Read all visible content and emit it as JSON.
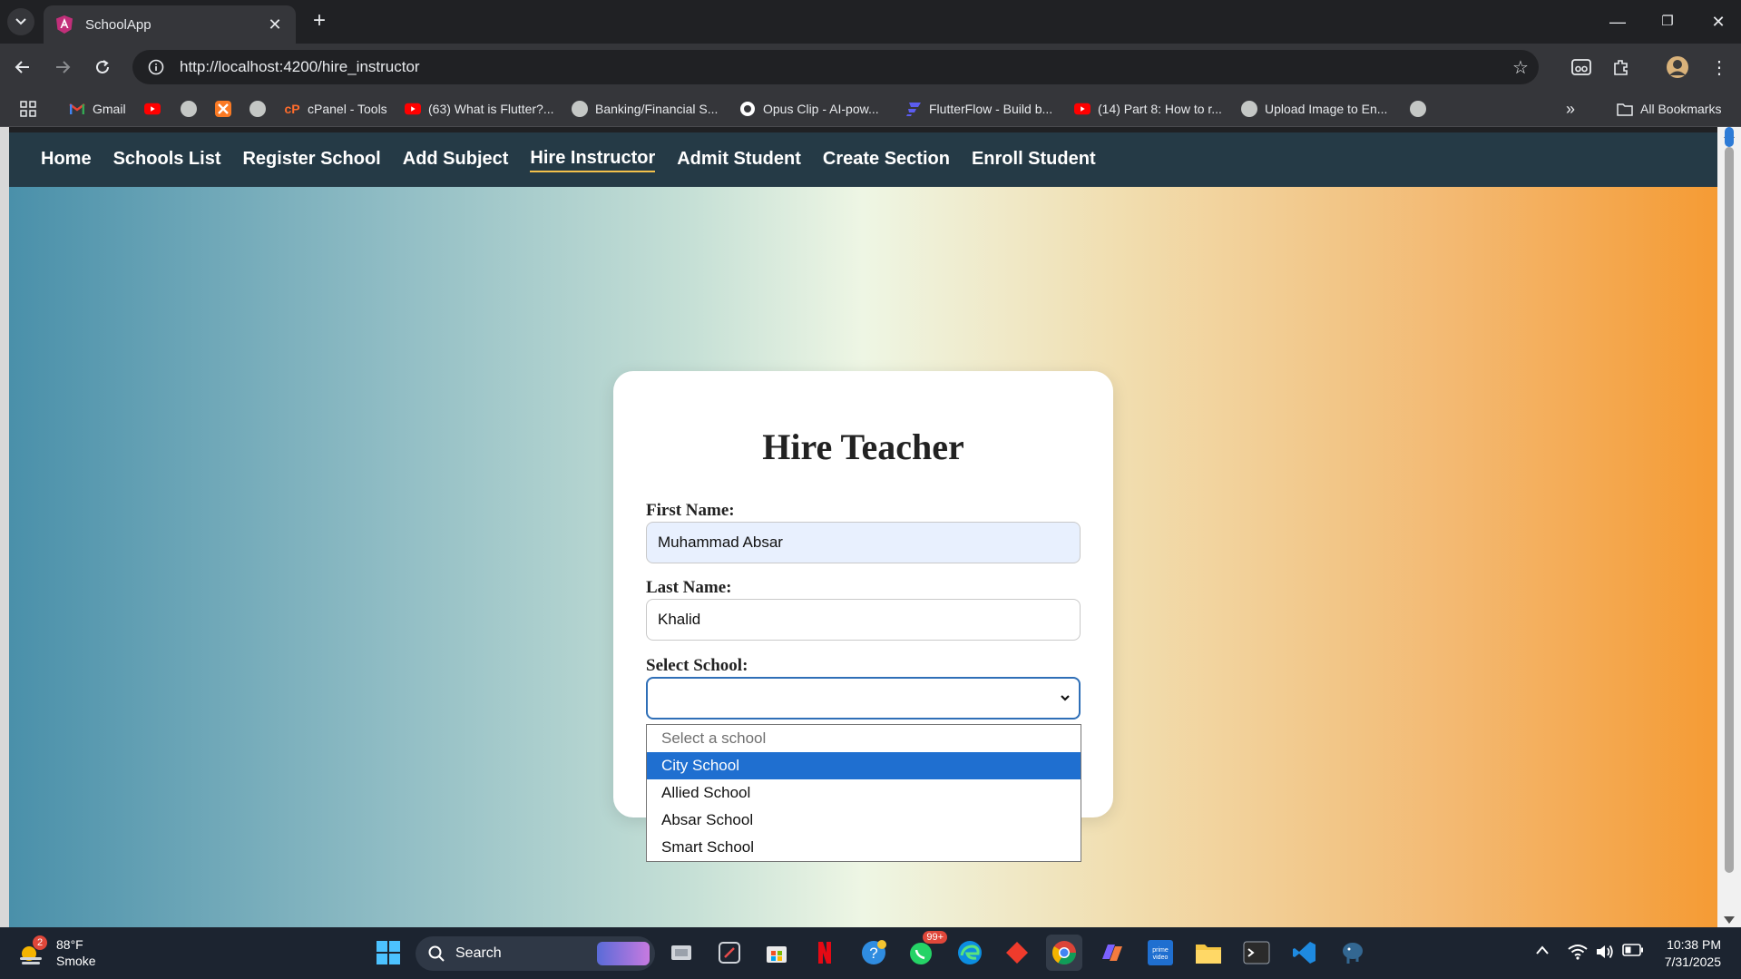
{
  "browser": {
    "tab_title": "SchoolApp",
    "url": "http://localhost:4200/hire_instructor",
    "bookmarks": [
      {
        "label": "Gmail",
        "icon": "gmail-icon"
      },
      {
        "label": "",
        "icon": "youtube-icon"
      },
      {
        "label": "",
        "icon": "globe-icon"
      },
      {
        "label": "",
        "icon": "xampp-icon"
      },
      {
        "label": "",
        "icon": "globe-icon"
      },
      {
        "label": "cPanel - Tools",
        "icon": "cpanel-icon"
      },
      {
        "label": "(63) What is Flutter?...",
        "icon": "youtube-icon"
      },
      {
        "label": "Banking/Financial S...",
        "icon": "globe-icon"
      },
      {
        "label": "Opus Clip - AI-pow...",
        "icon": "opus-icon"
      },
      {
        "label": "FlutterFlow - Build b...",
        "icon": "flutterflow-icon"
      },
      {
        "label": "(14) Part 8: How to r...",
        "icon": "youtube-icon"
      },
      {
        "label": "Upload Image to En...",
        "icon": "globe-icon"
      },
      {
        "label": "",
        "icon": "globe-icon"
      }
    ],
    "all_bookmarks": "All Bookmarks"
  },
  "nav": {
    "links": [
      "Home",
      "Schools List",
      "Register School",
      "Add Subject",
      "Hire Instructor",
      "Admit Student",
      "Create Section",
      "Enroll Student"
    ],
    "active": "Hire Instructor"
  },
  "form": {
    "title": "Hire Teacher",
    "first_name_label": "First Name:",
    "first_name_value": "Muhammad Absar",
    "last_name_label": "Last Name:",
    "last_name_value": "Khalid",
    "school_label": "Select School:",
    "school_value": "",
    "school_options": [
      "Select a school",
      "City School",
      "Allied School",
      "Absar School",
      "Smart School"
    ],
    "highlighted_option": "City School"
  },
  "taskbar": {
    "weather_temp": "88°F",
    "weather_desc": "Smoke",
    "weather_badge": "2",
    "search_label": "Search",
    "whatsapp_badge": "99+",
    "time": "10:38 PM",
    "date": "7/31/2025"
  },
  "colors": {
    "navbar": "#253a46",
    "active_underline": "#f3c14b",
    "gradient_left": "#4a90aa",
    "gradient_right": "#f59b34",
    "option_highlight": "#1f6fd0"
  }
}
